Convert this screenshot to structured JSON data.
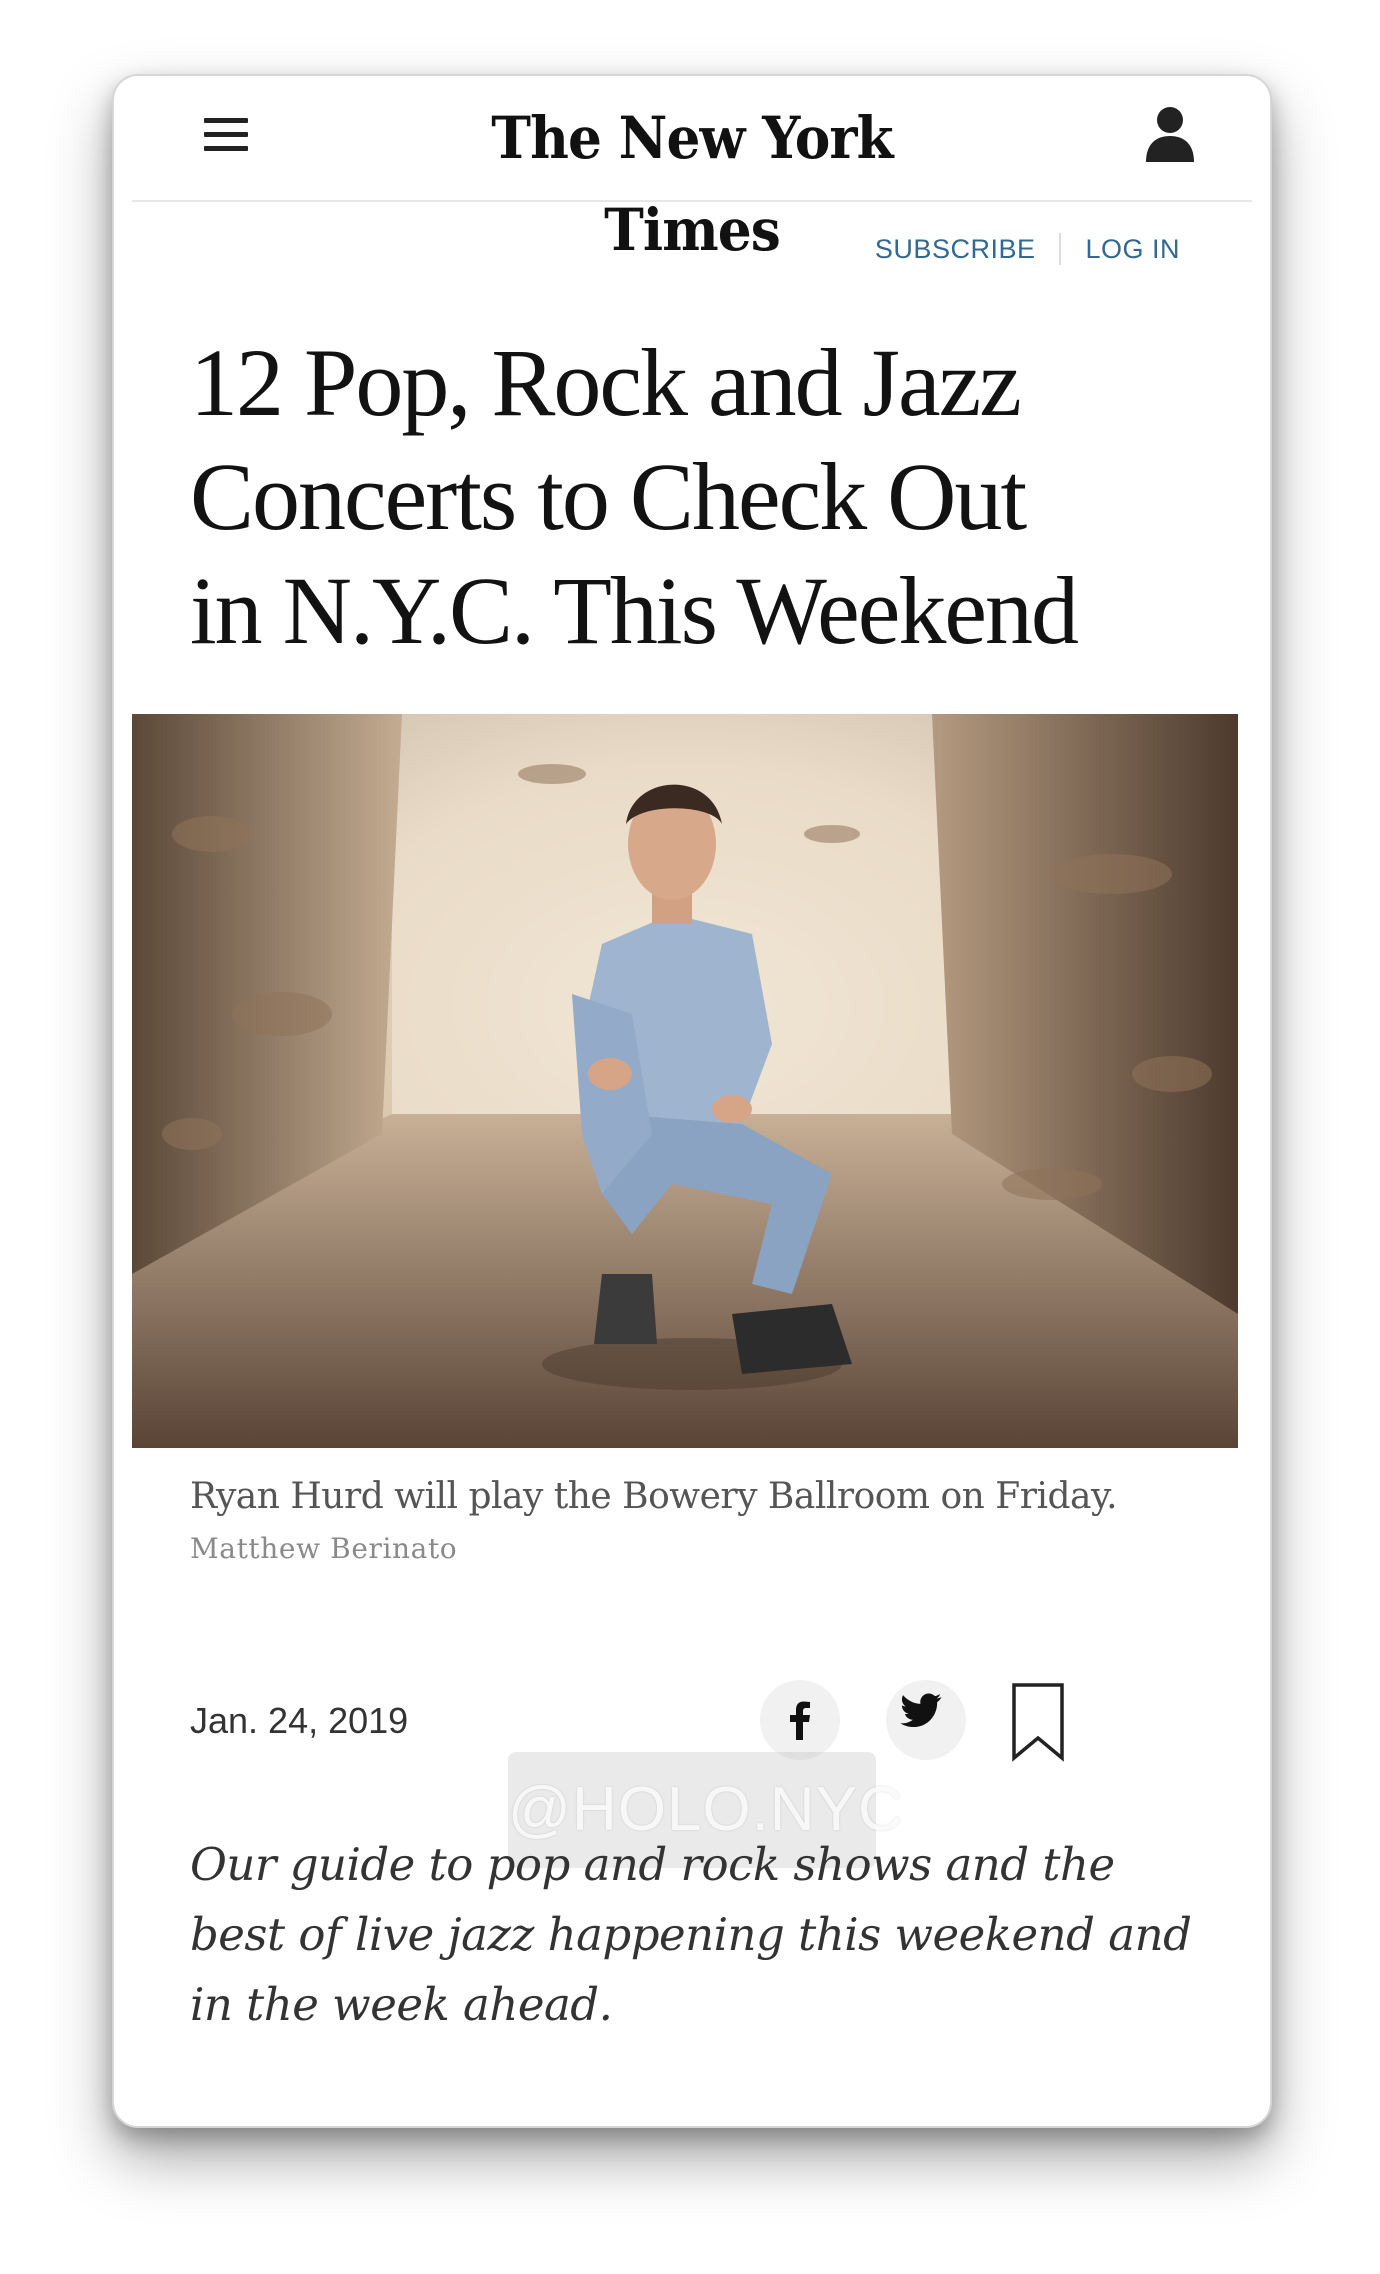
{
  "header": {
    "logo_text": "The New York Times",
    "menu_icon": "hamburger-menu-icon",
    "account_icon": "user-account-icon"
  },
  "auth": {
    "subscribe_label": "SUBSCRIBE",
    "login_label": "LOG IN",
    "link_color": "#326891"
  },
  "article": {
    "headline_lines": [
      "12 Pop, Rock and Jazz",
      "Concerts to Check Out",
      "in N.Y.C. This Weekend"
    ],
    "image": {
      "caption": "Ryan Hurd will play the Bowery Ballroom on Friday.",
      "credit": "Matthew Berinato"
    },
    "date": "Jan. 24, 2019",
    "share": {
      "facebook_icon": "facebook-icon",
      "twitter_icon": "twitter-icon",
      "bookmark_icon": "bookmark-icon"
    },
    "summary": "Our guide to pop and rock shows and the best of live jazz happening this weekend and in the week ahead."
  },
  "overlay": {
    "watermark": "@HOLO.NYC"
  }
}
